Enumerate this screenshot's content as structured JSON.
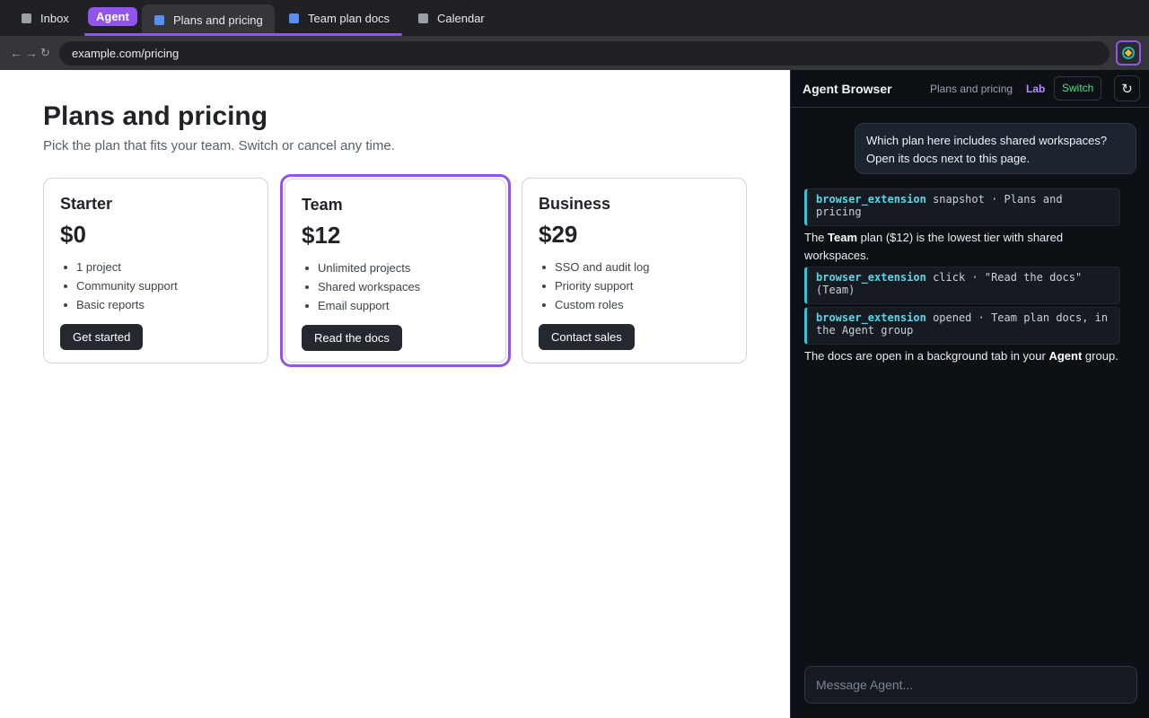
{
  "tabs": {
    "inbox": "Inbox",
    "group_label": "Agent",
    "plans": "Plans and pricing",
    "docs": "Team plan docs",
    "calendar": "Calendar"
  },
  "toolbar": {
    "back": "←",
    "forward": "→",
    "reload": "↻",
    "url": "example.com/pricing",
    "extension_icon": "agent-extension-icon"
  },
  "page": {
    "title": "Plans and pricing",
    "subtitle": "Pick the plan that fits your team. Switch or cancel any time.",
    "plans": [
      {
        "name": "Starter",
        "price": "$0",
        "features": [
          "1 project",
          "Community support",
          "Basic reports"
        ],
        "cta": "Get started"
      },
      {
        "name": "Team",
        "price": "$12",
        "features": [
          "Unlimited projects",
          "Shared workspaces",
          "Email support"
        ],
        "cta": "Read the docs"
      },
      {
        "name": "Business",
        "price": "$29",
        "features": [
          "SSO and audit log",
          "Priority support",
          "Custom roles"
        ],
        "cta": "Contact sales"
      }
    ],
    "highlighted_plan": "Team"
  },
  "agent": {
    "title": "Agent Browser",
    "context": "Plans and pricing",
    "context_tag": "Lab",
    "switch_label": "Switch",
    "refresh_icon": "↻",
    "user_message": "Which plan here includes shared workspaces? Open its docs next to this page.",
    "tools": [
      {
        "name": "browser_extension",
        "text": "snapshot · Plans and pricing"
      },
      {
        "name": "browser_extension",
        "text": "click · \"Read the docs\" (Team)"
      },
      {
        "name": "browser_extension",
        "text": "opened · Team plan docs, in the Agent group"
      }
    ],
    "reply1": {
      "pre": "The ",
      "bold": "Team",
      "post": " plan ($12) is the lowest tier with shared workspaces."
    },
    "reply2": {
      "pre": "The docs are open in a background tab in your ",
      "bold": "Agent",
      "post": " group."
    },
    "composer_placeholder": "Message Agent..."
  },
  "colors": {
    "accent": "#9255ea",
    "tool_accent": "#36c1d6",
    "switch_text": "#5fd98a"
  }
}
